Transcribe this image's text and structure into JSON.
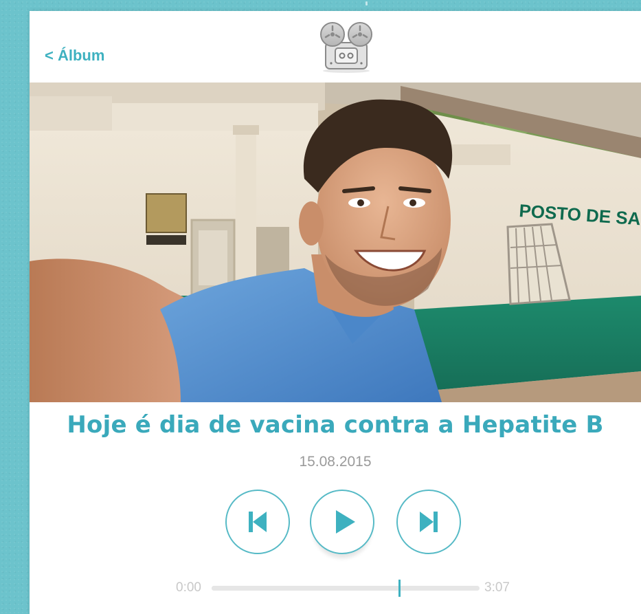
{
  "header": {
    "back_label": "< Álbum",
    "logo_icon": "film-projector-icon"
  },
  "hero": {
    "sign_text": "POSTO DE SAÚDE"
  },
  "track": {
    "title": "Hoje é dia de vacina contra a Hepatite B",
    "date": "15.08.2015"
  },
  "controls": {
    "prev_icon": "skip-previous-icon",
    "play_icon": "play-icon",
    "next_icon": "skip-next-icon"
  },
  "progress": {
    "current_time": "0:00",
    "total_time": "3:07",
    "position_fraction": 0.7
  },
  "colors": {
    "accent": "#3eb1c0",
    "background": "#6cc3cc",
    "wall_green": "#1f8a6b"
  }
}
